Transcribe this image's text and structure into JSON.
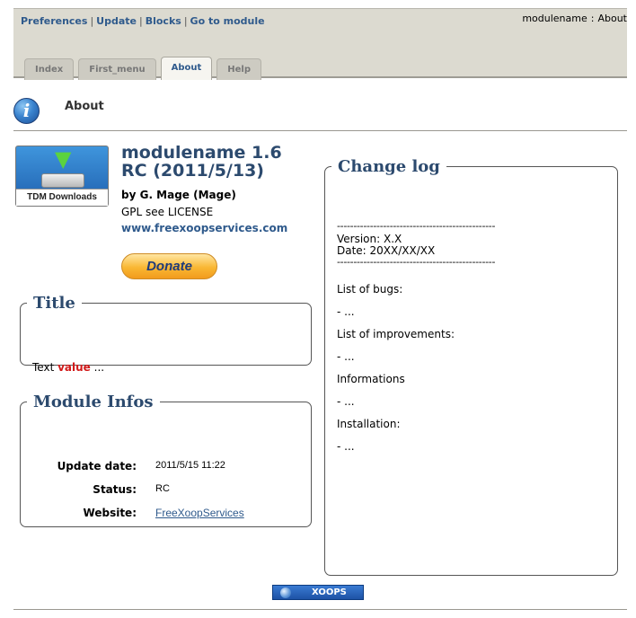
{
  "toplinks": [
    "Preferences",
    "Update",
    "Blocks",
    "Go to module"
  ],
  "breadcrumb": {
    "module": "modulename",
    "separator": ":",
    "page": "About"
  },
  "tabs": [
    {
      "label": "Index",
      "active": false
    },
    {
      "label": "First_menu",
      "active": false
    },
    {
      "label": "About",
      "active": true
    },
    {
      "label": "Help",
      "active": false
    }
  ],
  "page_title": "About",
  "logo": {
    "label": "TDM Downloads"
  },
  "module": {
    "name": "modulename 1.6 RC (2011/5/13)",
    "author": "by G. Mage (Mage)",
    "license": "GPL see LICENSE",
    "website": "www.freexoopservices.com"
  },
  "donate_label": "Donate",
  "title_box": {
    "legend": "Title",
    "text_prefix": "Text",
    "value": "value",
    "suffix": "..."
  },
  "module_infos": {
    "legend": "Module Infos",
    "rows": [
      {
        "key": "Update date:",
        "value": "2011/5/15 11:22"
      },
      {
        "key": "Status:",
        "value": "RC"
      },
      {
        "key": "Website:",
        "value": "FreeXoopServices"
      }
    ]
  },
  "changelog": {
    "legend": "Change log",
    "separator": "------------------------------------------------",
    "version": "Version: X.X",
    "date": "Date: 20XX/XX/XX",
    "sections": [
      {
        "heading": "List of bugs:",
        "item": "- ..."
      },
      {
        "heading": "List of improvements:",
        "item": "- ..."
      },
      {
        "heading": "Informations",
        "item": "- ..."
      },
      {
        "heading": "Installation:",
        "item": "- ..."
      }
    ]
  },
  "footer_badge": "XOOPS"
}
